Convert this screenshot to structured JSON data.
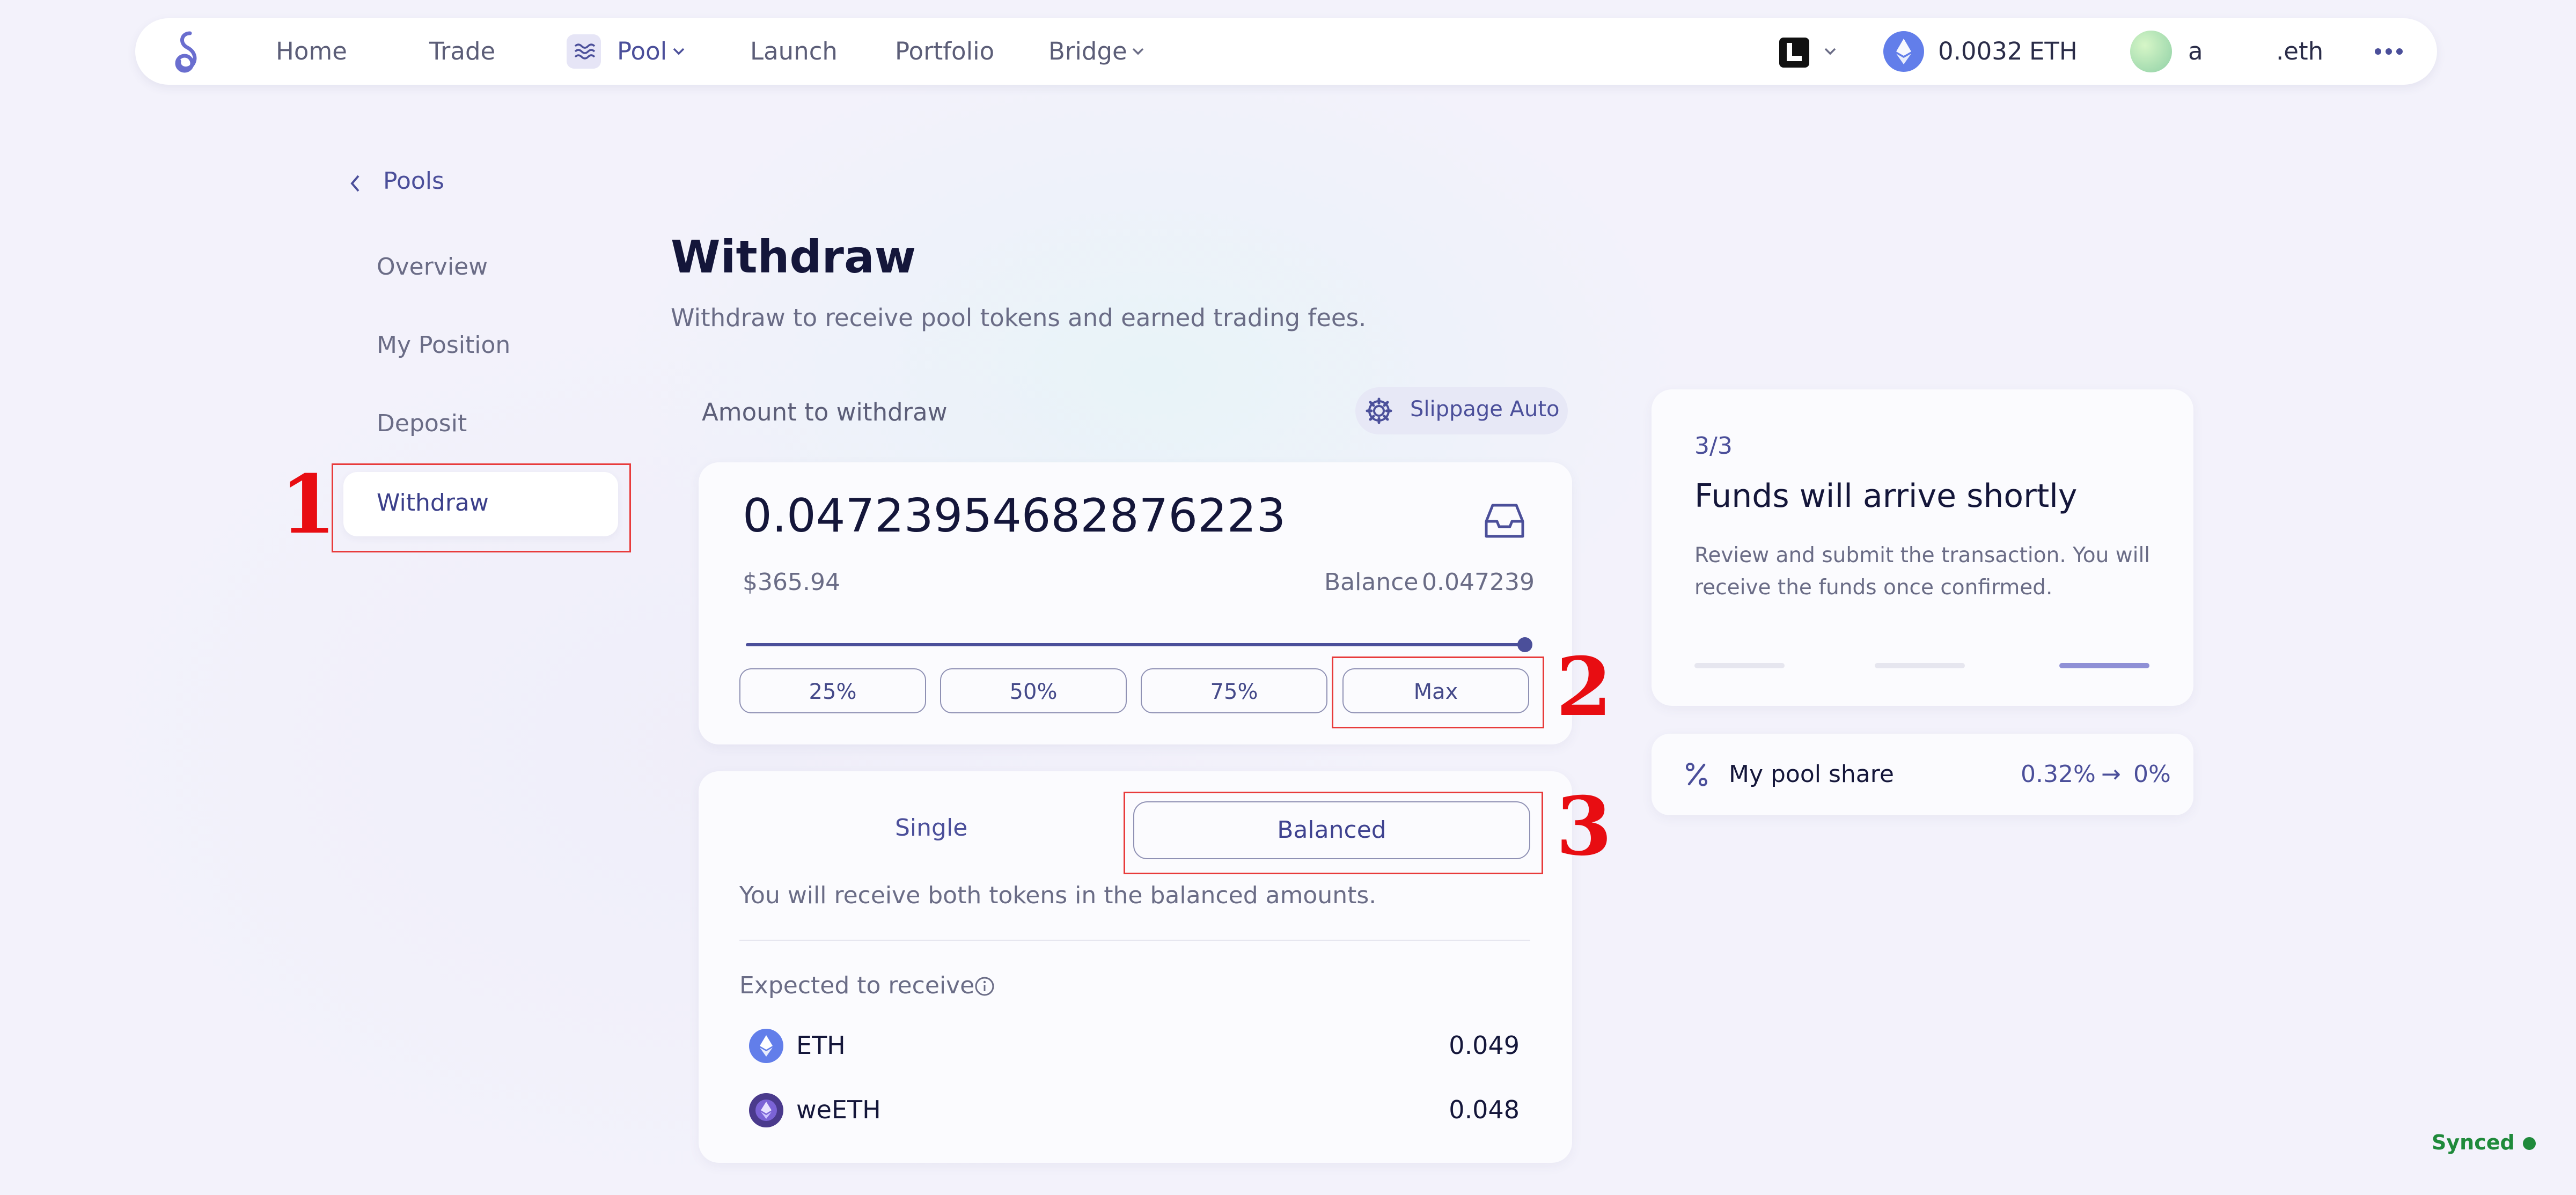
{
  "nav": {
    "items": [
      "Home",
      "Trade",
      "Pool",
      "Launch",
      "Portfolio",
      "Bridge"
    ],
    "eth_amount": "0.0032",
    "eth_unit": "ETH",
    "account_name": "a",
    "ens_suffix": ".eth"
  },
  "sidebar": {
    "back_label": "Pools",
    "items": [
      "Overview",
      "My Position",
      "Deposit",
      "Withdraw"
    ]
  },
  "page": {
    "title": "Withdraw",
    "subtitle": "Withdraw to receive pool tokens and earned trading fees."
  },
  "amount_card": {
    "label": "Amount to withdraw",
    "slippage_label": "Slippage Auto",
    "value": "0.04723954682876223",
    "usd_value": "$365.94",
    "balance_label": "Balance",
    "balance_value": "0.047239",
    "slider_fraction": 1.0,
    "percent_buttons": [
      "25%",
      "50%",
      "75%",
      "Max"
    ]
  },
  "mode_card": {
    "tabs": [
      "Single",
      "Balanced"
    ],
    "selected_tab": "Balanced",
    "description": "You will receive both tokens in the balanced amounts.",
    "expected_label": "Expected to receive",
    "tokens": [
      {
        "symbol": "ETH",
        "amount": "0.049"
      },
      {
        "symbol": "weETH",
        "amount": "0.048"
      }
    ]
  },
  "status_card": {
    "step": "3/3",
    "title": "Funds will arrive shortly",
    "body": "Review and submit the transaction. You will receive the funds once confirmed.",
    "progress_steps": 3,
    "active_step": 3
  },
  "pool_share": {
    "label": "My pool share",
    "from": "0.32%",
    "arrow": "→",
    "to": "0%"
  },
  "annotations": [
    "1",
    "2",
    "3"
  ],
  "status": {
    "text": "Synced"
  },
  "colors": {
    "accent": "#4b4f9a",
    "annotation_red": "#e80d12",
    "synced_green": "#1f8a3b"
  }
}
